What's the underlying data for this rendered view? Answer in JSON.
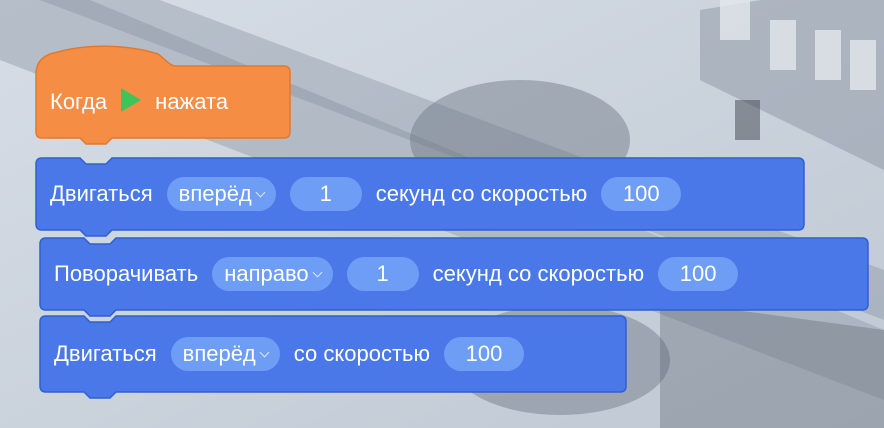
{
  "colors": {
    "event_block": "#f58d45",
    "motion_block": "#4a78e8",
    "motion_block_border": "#2f5fd0",
    "field": "#6e9df5",
    "flag": "#3ec45b",
    "background": "#c9d2dd"
  },
  "event_block": {
    "label_before": "Когда",
    "icon": "green-flag-icon",
    "label_after": "нажата"
  },
  "blocks": [
    {
      "label": "Двигаться",
      "direction": "вперёд",
      "seconds": "1",
      "seconds_label": "секунд со скоростью",
      "speed": "100"
    },
    {
      "label": "Поворачивать",
      "direction": "направо",
      "seconds": "1",
      "seconds_label": "секунд со скоростью",
      "speed": "100"
    },
    {
      "label": "Двигаться",
      "direction": "вперёд",
      "speed_label": "со скоростью",
      "speed": "100"
    }
  ]
}
